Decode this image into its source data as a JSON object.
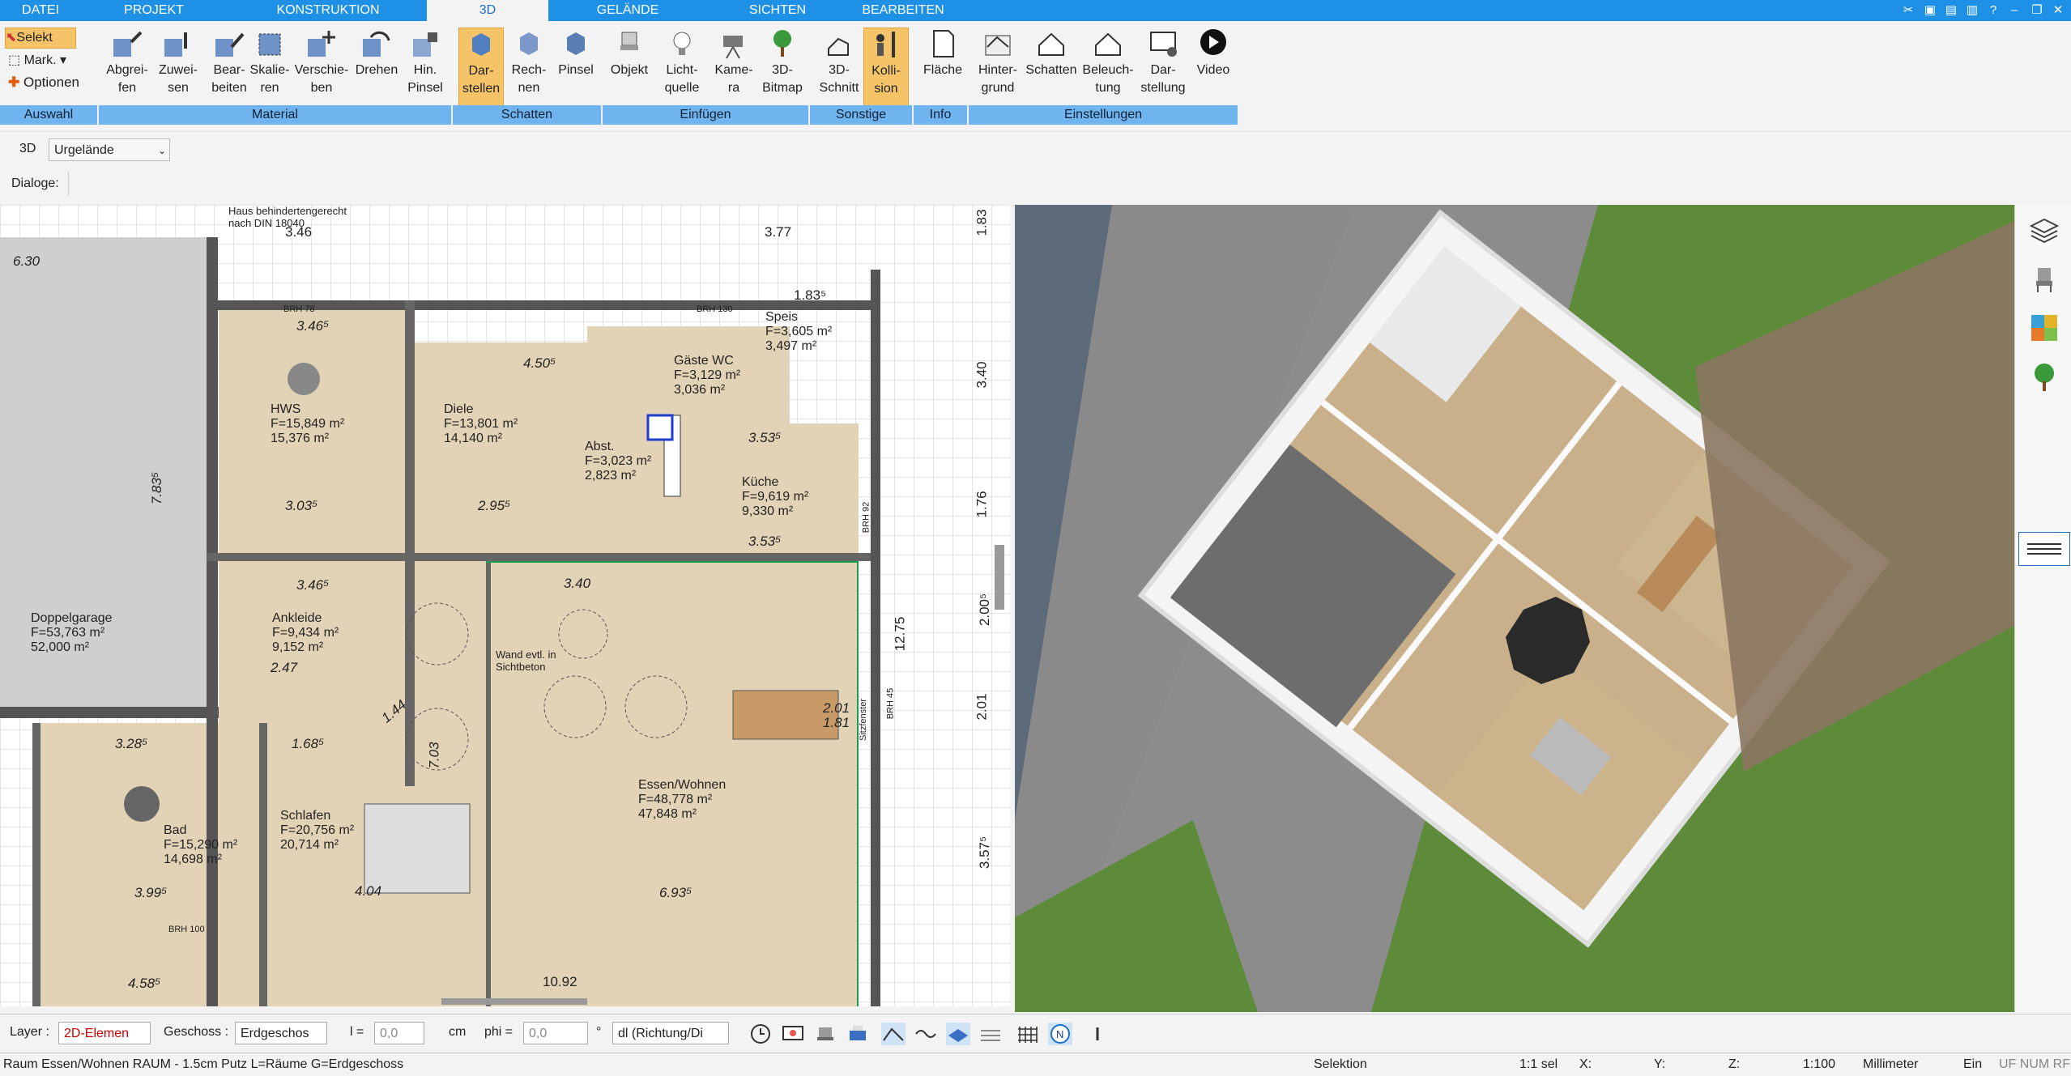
{
  "menu": {
    "tabs": [
      {
        "label": "DATEI",
        "active": false
      },
      {
        "label": "PROJEKT",
        "active": false
      },
      {
        "label": "KONSTRUKTION",
        "active": false
      },
      {
        "label": "3D",
        "active": true
      },
      {
        "label": "GELÄNDE",
        "active": false
      },
      {
        "label": "SICHTEN",
        "active": false
      },
      {
        "label": "BEARBEITEN",
        "active": false
      }
    ]
  },
  "ribbon": {
    "auswahl": {
      "selekt": "Selekt",
      "mark": "Mark.",
      "optionen": "Optionen",
      "group": "Auswahl"
    },
    "material": {
      "group": "Material",
      "buttons": [
        "Abgrei-\nfen",
        "Zuwei-\nsen",
        "Bear-\nbeiten",
        "Skalie-\nren",
        "Verschie-\nben",
        "Drehen",
        "Hin.\nPinsel"
      ]
    },
    "schatten": {
      "group": "Schatten",
      "buttons": [
        "Dar-\nstellen",
        "Rech-\nnen",
        "Pinsel"
      ]
    },
    "einfuegen": {
      "group": "Einfügen",
      "buttons": [
        "Objekt",
        "Licht-\nquelle",
        "Kame-\nra",
        "3D-\nBitmap"
      ]
    },
    "sonstige": {
      "group": "Sonstige",
      "buttons": [
        "3D-\nSchnitt",
        "Kolli-\nsion"
      ]
    },
    "info": {
      "group": "Info",
      "buttons": [
        "Fläche"
      ]
    },
    "einstellungen": {
      "group": "Einstellungen",
      "buttons": [
        "Hinter-\ngrund",
        "Schatten",
        "Beleuch-\ntung",
        "Dar-\nstellung",
        "Video"
      ]
    }
  },
  "row3d": {
    "label": "3D",
    "dropdown": "Urgelände"
  },
  "rowdlg": {
    "label": "Dialoge:"
  },
  "plan": {
    "rooms": [
      {
        "name": "HWS",
        "area1": "F=15,849 m²",
        "area2": "15,376 m²"
      },
      {
        "name": "Diele",
        "area1": "F=13,801 m²",
        "area2": "14,140 m²"
      },
      {
        "name": "Gäste WC",
        "area1": "F=3,129 m²",
        "area2": "3,036 m²"
      },
      {
        "name": "Speis",
        "area1": "F=3,605 m²",
        "area2": "3,497 m²"
      },
      {
        "name": "Abst.",
        "area1": "F=3,023 m²",
        "area2": "2,823 m²"
      },
      {
        "name": "Küche",
        "area1": "F=9,619 m²",
        "area2": "9,330 m²"
      },
      {
        "name": "Ankleide",
        "area1": "F=9,434 m²",
        "area2": "9,152 m²"
      },
      {
        "name": "Doppelgarage",
        "area1": "F=53,763 m²",
        "area2": "52,000 m²"
      },
      {
        "name": "Schlafen",
        "area1": "F=20,756 m²",
        "area2": "20,714 m²"
      },
      {
        "name": "Bad",
        "area1": "F=15,290 m²",
        "area2": "14,698 m²"
      },
      {
        "name": "Essen/Wohnen",
        "area1": "F=48,778 m²",
        "area2": "47,848 m²"
      }
    ],
    "notes": {
      "din": "Haus behindertengerecht nach DIN 18040",
      "wand": "Wand evtl. in Sichtbeton",
      "brh78": "BRH 78",
      "brh130": "BRH 130",
      "brh100": "BRH 100",
      "brh45": "BRH 45",
      "brh92": "BRH 92",
      "sitzfenster": "Sitzfenster"
    },
    "dims": {
      "d346a": "3.46",
      "d346b": "3.46⁵",
      "d346c": "3.46⁵",
      "d377": "3.77",
      "d183": "1.83⁵",
      "d630": "6.30",
      "d450": "4.50⁵",
      "d303": "3.03⁵",
      "d295": "2.95⁵",
      "d247": "2.47",
      "d328": "3.28⁵",
      "d168": "1.68⁵",
      "d404": "4.04",
      "d693": "6.93⁵",
      "d399": "3.99⁵",
      "d458": "4.58⁵",
      "d1092": "10.92",
      "d353": "3.53⁵",
      "d353b": "3.53⁵",
      "d340": "3.40",
      "d201": "2.01",
      "d144": "1.44",
      "d1275": "12.75",
      "d783": "7.83⁵",
      "d703": "7.03",
      "d181": "1.81",
      "d340v": "3.40",
      "d176": "1.76",
      "d200": "2.00⁵",
      "d201v": "2.01",
      "d357": "3.57⁵",
      "d183v": "1.83"
    }
  },
  "bottom": {
    "layer_label": "Layer :",
    "layer_value": "2D-Elemen",
    "geschoss_label": "Geschoss :",
    "geschoss_value": "Erdgeschos",
    "l_label": "l =",
    "l_value": "0,0",
    "l_unit": "cm",
    "phi_label": "phi =",
    "phi_value": "0,0",
    "phi_unit": "°",
    "dl_value": "dl (Richtung/Di"
  },
  "status": {
    "left": "Raum Essen/Wohnen RAUM - 1.5cm Putz L=Räume G=Erdgeschoss",
    "mode": "Selektion",
    "sel": "1:1 sel",
    "x": "X:",
    "y": "Y:",
    "z": "Z:",
    "scale": "1:100",
    "unit": "Millimeter",
    "ein": "Ein",
    "flags": "UF  NUM  RF"
  },
  "colors": {
    "accent": "#1e90e6",
    "group_bar": "#6fb3ef",
    "highlight": "#f5c468",
    "floor": "#e3d3b6",
    "grass": "#5d8b3a"
  }
}
